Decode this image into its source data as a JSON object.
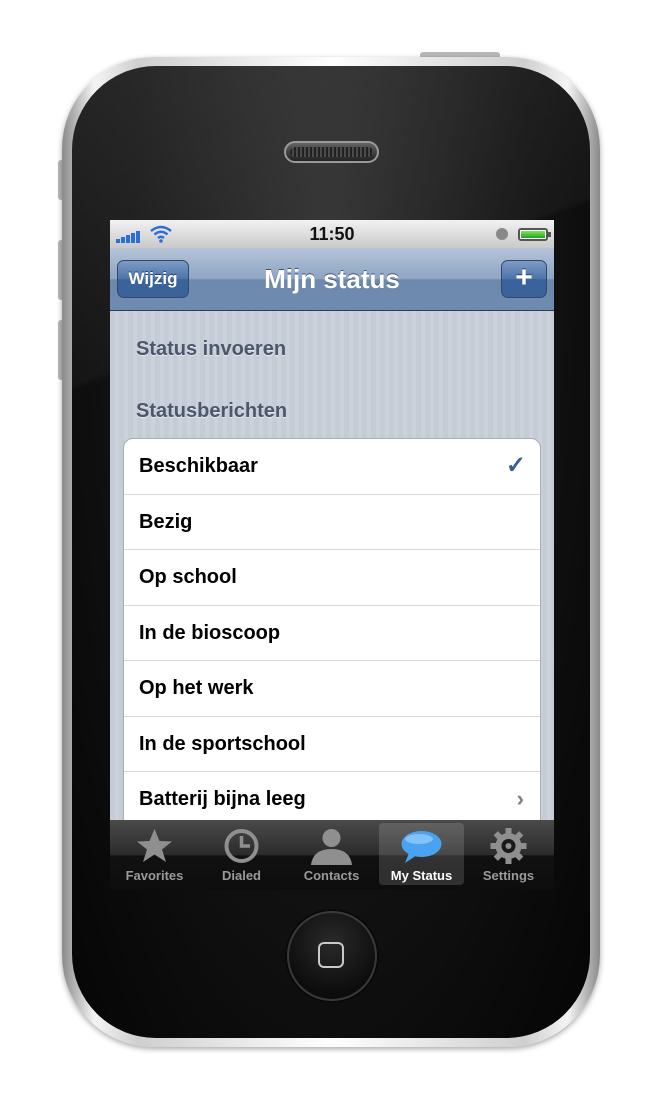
{
  "statusbar": {
    "time": "11:50"
  },
  "navbar": {
    "title": "Mijn status",
    "edit_label": "Wijzig",
    "add_label": "+"
  },
  "sections": {
    "enter_status": "Status invoeren",
    "status_messages": "Statusberichten"
  },
  "status_list": [
    {
      "label": "Beschikbaar",
      "accessory": "checkmark"
    },
    {
      "label": "Bezig",
      "accessory": ""
    },
    {
      "label": "Op school",
      "accessory": ""
    },
    {
      "label": "In de bioscoop",
      "accessory": ""
    },
    {
      "label": "Op het werk",
      "accessory": ""
    },
    {
      "label": "In de sportschool",
      "accessory": ""
    },
    {
      "label": "Batterij bijna leeg",
      "accessory": "chevron"
    }
  ],
  "accessories": {
    "checkmark": "✓",
    "chevron": "›"
  },
  "tabbar": {
    "tabs": [
      {
        "label": "Favorites",
        "icon": "star-icon",
        "selected": false
      },
      {
        "label": "Dialed",
        "icon": "clock-icon",
        "selected": false
      },
      {
        "label": "Contacts",
        "icon": "person-icon",
        "selected": false
      },
      {
        "label": "My Status",
        "icon": "speech-bubble-icon",
        "selected": true
      },
      {
        "label": "Settings",
        "icon": "gear-icon",
        "selected": false
      }
    ]
  },
  "colors": {
    "navbar": "#6e8aae",
    "nav_button": "#3b6399",
    "signal": "#2b6ed8",
    "checkmark": "#3a5f94",
    "selected_tab_icon": "#4aa3f0"
  }
}
